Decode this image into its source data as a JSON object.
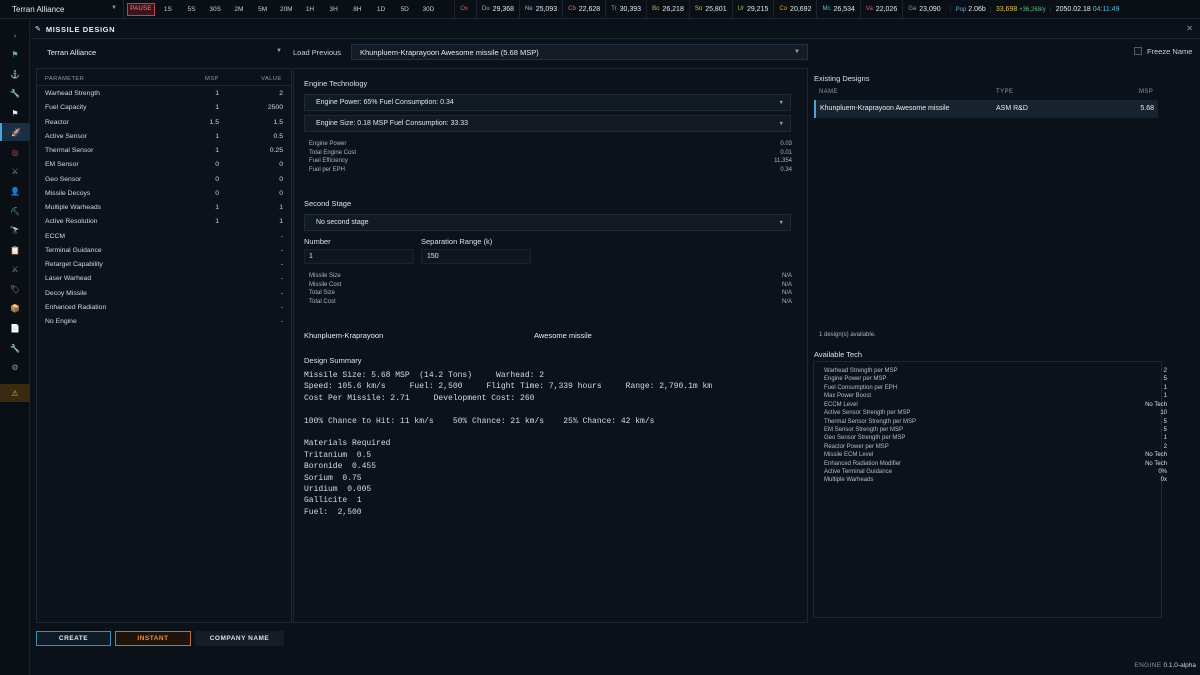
{
  "topbar": {
    "empire": "Terran Alliance",
    "pause": "PAUSE",
    "speeds": [
      "1S",
      "5S",
      "30S",
      "2M",
      "5M",
      "20M",
      "1H",
      "3H",
      "8H",
      "1D",
      "5D",
      "30D"
    ],
    "resources": [
      {
        "ab": "Ox",
        "value": "",
        "color": "#e05a4a"
      },
      {
        "ab": "Du",
        "value": "29,368",
        "color": "#8fa6c6"
      },
      {
        "ab": "Ne",
        "value": "25,093",
        "color": "#8fb8e0"
      },
      {
        "ab": "Cb",
        "value": "22,628",
        "color": "#e07a4a"
      },
      {
        "ab": "Tr",
        "value": "30,393",
        "color": "#6fb0d8"
      },
      {
        "ab": "Bo",
        "value": "26,218",
        "color": "#d8a84a"
      },
      {
        "ab": "So",
        "value": "25,801",
        "color": "#e0c050"
      },
      {
        "ab": "Ur",
        "value": "29,215",
        "color": "#8fd05a"
      },
      {
        "ab": "Co",
        "value": "20,692",
        "color": "#e0984a"
      },
      {
        "ab": "Mc",
        "value": "26,534",
        "color": "#5ac0d0"
      },
      {
        "ab": "Va",
        "value": "22,026",
        "color": "#e06060"
      },
      {
        "ab": "Ga",
        "value": "23,090",
        "color": "#8a98a8"
      }
    ],
    "pop_label": "Pop",
    "pop_value": "2.06b",
    "wealth": "33,698",
    "wealth_rate": "+36,268/y",
    "date": "2050.02.18",
    "time": "04:11:49"
  },
  "window": {
    "title": "MISSILE DESIGN"
  },
  "design": {
    "empire_select": "Terran Alliance",
    "load_previous_label": "Load Previous",
    "load_previous_value": "Khunpluem-Kraprayoon Awesome missile (5.68 MSP)",
    "freeze_name_label": "Freeze Name"
  },
  "params": {
    "headers": {
      "parameter": "PARAMETER",
      "msp": "MSP",
      "value": "VALUE"
    },
    "rows": [
      {
        "name": "Warhead Strength",
        "msp": "1",
        "value": "2"
      },
      {
        "name": "Fuel Capacity",
        "msp": "1",
        "value": "2500"
      },
      {
        "name": "Reactor",
        "msp": "1.5",
        "value": "1.5"
      },
      {
        "name": "Active Sensor",
        "msp": "1",
        "value": "0.5"
      },
      {
        "name": "Thermal Sensor",
        "msp": "1",
        "value": "0.25"
      },
      {
        "name": "EM Sensor",
        "msp": "0",
        "value": "0"
      },
      {
        "name": "Geo Sensor",
        "msp": "0",
        "value": "0"
      },
      {
        "name": "Missile Decoys",
        "msp": "0",
        "value": "0"
      },
      {
        "name": "Multiple Warheads",
        "msp": "1",
        "value": "1"
      },
      {
        "name": "Active Resolution",
        "msp": "1",
        "value": "1"
      },
      {
        "name": "ECCM",
        "msp": "",
        "value": "-"
      },
      {
        "name": "Terminal Guidance",
        "msp": "",
        "value": "-"
      },
      {
        "name": "Retarget Capability",
        "msp": "",
        "value": "-"
      },
      {
        "name": "Laser Warhead",
        "msp": "",
        "value": "-"
      },
      {
        "name": "Decoy Missile",
        "msp": "",
        "value": "-"
      },
      {
        "name": "Enhanced Radiation",
        "msp": "",
        "value": "-"
      },
      {
        "name": "No Engine",
        "msp": "",
        "value": "-"
      }
    ]
  },
  "engine": {
    "heading": "Engine Technology",
    "power_select": "Engine Power: 65% Fuel Consumption: 0.34",
    "size_select": "Engine Size: 0.18 MSP Fuel Consumption: 33.33",
    "stats": [
      {
        "label": "Engine Power",
        "value": "0.03"
      },
      {
        "label": "Total Engine Cost",
        "value": "0.01"
      },
      {
        "label": "Fuel Efficiency",
        "value": "11.354"
      },
      {
        "label": "Fuel per EPH",
        "value": "0.34"
      }
    ]
  },
  "second_stage": {
    "heading": "Second Stage",
    "select": "No second stage",
    "number_label": "Number",
    "number_value": "1",
    "sep_label": "Separation Range (k)",
    "sep_value": "150",
    "stats": [
      {
        "label": "Missile Size",
        "value": "N/A"
      },
      {
        "label": "Missile Cost",
        "value": "N/A"
      },
      {
        "label": "Total Size",
        "value": "N/A"
      },
      {
        "label": "Total Cost",
        "value": "N/A"
      }
    ]
  },
  "naming": {
    "name1": "Khunpluem-Kraprayoon",
    "name2": "Awesome missile"
  },
  "summary": {
    "heading": "Design Summary",
    "lines": [
      "Missile Size: 5.68 MSP  (14.2 Tons)     Warhead: 2",
      "Speed: 105.6 km/s     Fuel: 2,500     Flight Time: 7,339 hours     Range: 2,790.1m km",
      "Cost Per Missile: 2.71     Development Cost: 260",
      "",
      "100% Chance to Hit: 11 km/s    50% Chance: 21 km/s    25% Chance: 42 km/s",
      "",
      "Materials Required",
      "Tritanium  0.5",
      "Boronide  0.455",
      "Sorium  0.75",
      "Uridium  0.005",
      "Gallicite  1",
      "Fuel:  2,500"
    ]
  },
  "existing": {
    "heading": "Existing Designs",
    "headers": {
      "name": "NAME",
      "type": "TYPE",
      "msp": "MSP"
    },
    "rows": [
      {
        "name": "Khunpluem-Kraprayoon Awesome missile",
        "type": "ASM R&D",
        "msp": "5.68"
      }
    ],
    "count_text": "1 design(s) available."
  },
  "tech": {
    "heading": "Available Tech",
    "rows": [
      {
        "label": "Warhead Strength per MSP",
        "value": "2"
      },
      {
        "label": "Engine Power per MSP",
        "value": "5"
      },
      {
        "label": "Fuel Consumption per EPH",
        "value": "1"
      },
      {
        "label": "Max Power Boost",
        "value": "1"
      },
      {
        "label": "ECCM Level",
        "value": "No Tech"
      },
      {
        "label": "Active Sensor Strength per MSP",
        "value": "10"
      },
      {
        "label": "Thermal Sensor Strength per MSP",
        "value": "5"
      },
      {
        "label": "EM Sensor Strength per MSP",
        "value": "5"
      },
      {
        "label": "Geo Sensor Strength per MSP",
        "value": "1"
      },
      {
        "label": "Reactor Power per MSP",
        "value": "2"
      },
      {
        "label": "Missile ECM Level",
        "value": "No Tech"
      },
      {
        "label": "Enhanced Radiation Modifier",
        "value": "No Tech"
      },
      {
        "label": "Active Terminal Guidance",
        "value": "0%"
      },
      {
        "label": "Multiple Warheads",
        "value": "0x"
      }
    ]
  },
  "buttons": {
    "create": "CREATE",
    "instant": "INSTANT",
    "company": "COMPANY NAME"
  },
  "footer": {
    "engine": "ENGINE",
    "version": "0.1.0-alpha"
  },
  "colors": {
    "accent": "#47a6d8",
    "warn": "#e07a30",
    "pause": "#c04050"
  }
}
